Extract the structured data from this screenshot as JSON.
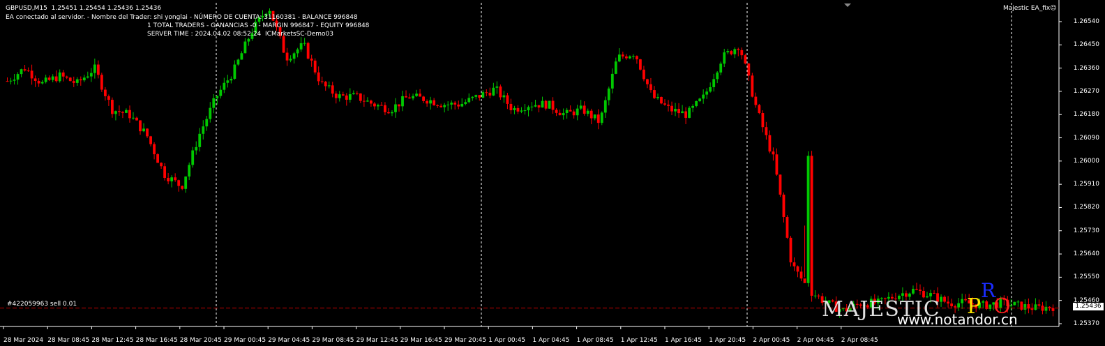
{
  "header": {
    "symbol_line": "GBPUSD,M15  1.25451 1.25454 1.25436 1.25436",
    "status_line": "EA conectado al servidor. - Nombre del Trader: shi yonglai - NÚMERO DE CUENTA: 31160381 - BALANCE 996848",
    "traders_line": "1 TOTAL TRADERS - GANANCIAS -0 - MARGIN 996847 - EQUITY 996848",
    "server_line": "SERVER TIME : 2024.04.02 08:52:24  ICMarketsSC-Demo03"
  },
  "ea_badge": "Majestic EA_fix☺",
  "order_label": "#422059963 sell 0.01",
  "current_price": "1.25436",
  "price_axis": [
    "1.26540",
    "1.26450",
    "1.26360",
    "1.26270",
    "1.26180",
    "1.26090",
    "1.26000",
    "1.25910",
    "1.25820",
    "1.25730",
    "1.25640",
    "1.25550",
    "1.25460",
    "1.25370"
  ],
  "time_axis": [
    "28 Mar 2024",
    "28 Mar 08:45",
    "28 Mar 12:45",
    "28 Mar 16:45",
    "28 Mar 20:45",
    "29 Mar 00:45",
    "29 Mar 04:45",
    "29 Mar 08:45",
    "29 Mar 12:45",
    "29 Mar 16:45",
    "29 Mar 20:45",
    "1 Apr 00:45",
    "1 Apr 04:45",
    "1 Apr 08:45",
    "1 Apr 12:45",
    "1 Apr 16:45",
    "1 Apr 20:45",
    "2 Apr 00:45",
    "2 Apr 04:45",
    "2 Apr 08:45"
  ],
  "logo": {
    "word": "MAJESTIC",
    "p": "P",
    "r": "R",
    "o": "O",
    "url": "www.notandor.cn"
  },
  "colors": {
    "bull": "#00c800",
    "bear": "#ff0000",
    "grid_sep": "#ffffff",
    "order_line": "#c00000",
    "background": "#000000"
  },
  "chart_data": {
    "type": "candlestick",
    "symbol": "GBPUSD",
    "timeframe": "M15",
    "ylim": [
      1.2537,
      1.2654
    ],
    "close_path": [
      1.2631,
      1.2636,
      1.263,
      1.2633,
      1.263,
      1.2636,
      1.262,
      1.2618,
      1.261,
      1.2595,
      1.259,
      1.261,
      1.2625,
      1.2635,
      1.265,
      1.266,
      1.264,
      1.2645,
      1.263,
      1.2625,
      1.2625,
      1.2622,
      1.262,
      1.2625,
      1.2624,
      1.2622,
      1.2622,
      1.2625,
      1.2628,
      1.262,
      1.2622,
      1.2622,
      1.2618,
      1.262,
      1.2615,
      1.264,
      1.2642,
      1.2625,
      1.262,
      1.2618,
      1.2625,
      1.264,
      1.2645,
      1.262,
      1.26,
      1.256,
      1.255,
      1.2545,
      1.2542,
      1.2545,
      1.2545,
      1.2548,
      1.255,
      1.2548,
      1.2545,
      1.2545,
      1.2544,
      1.2545,
      1.2544,
      1.2543,
      1.25436
    ],
    "orders": [
      {
        "ticket": "#422059963",
        "side": "sell",
        "volume": 0.01
      }
    ]
  }
}
